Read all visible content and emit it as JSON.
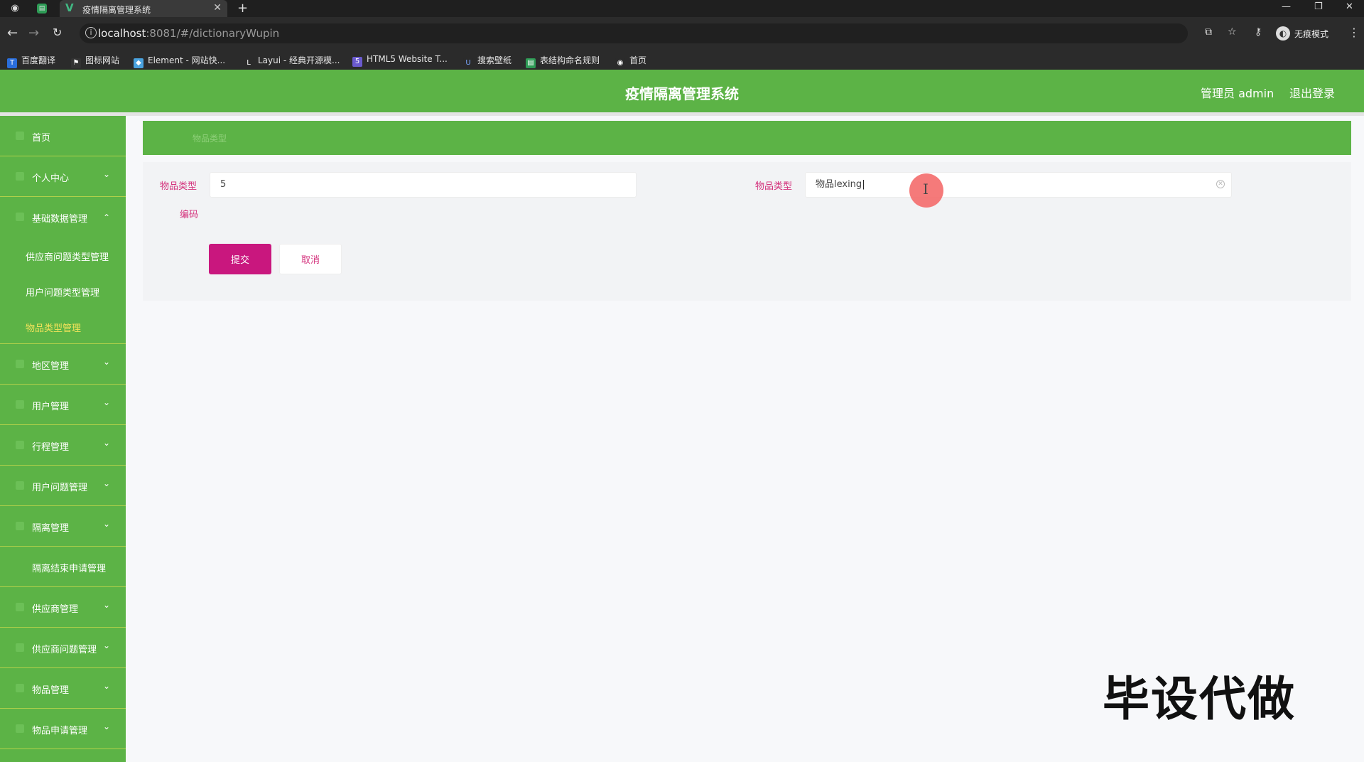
{
  "browser": {
    "tab_title": "疫情隔离管理系统",
    "url_host": "localhost",
    "url_path": ":8081/#/dictionaryWupin",
    "incognito_label": "无痕模式",
    "bookmarks": [
      "百度翻译",
      "图标网站",
      "Element - 网站快...",
      "Layui - 经典开源模...",
      "HTML5 Website T...",
      "搜索壁纸",
      "表结构命名规则",
      "首页"
    ]
  },
  "header": {
    "title": "疫情隔离管理系统",
    "user": "管理员 admin",
    "logout": "退出登录"
  },
  "sidebar": {
    "items": [
      {
        "label": "首页",
        "type": "item",
        "chevron": ""
      },
      {
        "label": "个人中心",
        "type": "item",
        "chevron": "⌄"
      },
      {
        "label": "基础数据管理",
        "type": "item",
        "chevron": "⌃"
      },
      {
        "label": "供应商问题类型管理",
        "type": "sub"
      },
      {
        "label": "用户问题类型管理",
        "type": "sub"
      },
      {
        "label": "物品类型管理",
        "type": "sub-active"
      },
      {
        "label": "地区管理",
        "type": "item",
        "chevron": "⌄"
      },
      {
        "label": "用户管理",
        "type": "item",
        "chevron": "⌄"
      },
      {
        "label": "行程管理",
        "type": "item",
        "chevron": "⌄"
      },
      {
        "label": "用户问题管理",
        "type": "item",
        "chevron": "⌄"
      },
      {
        "label": "隔离管理",
        "type": "item",
        "chevron": "⌄"
      },
      {
        "label": "隔离结束申请管理",
        "type": "item",
        "chevron": ""
      },
      {
        "label": "供应商管理",
        "type": "item",
        "chevron": "⌄"
      },
      {
        "label": "供应商问题管理",
        "type": "item",
        "chevron": "⌄"
      },
      {
        "label": "物品管理",
        "type": "item",
        "chevron": "⌄"
      },
      {
        "label": "物品申请管理",
        "type": "item",
        "chevron": "⌄"
      }
    ]
  },
  "breadcrumb": "物品类型",
  "form": {
    "code_label_line1": "物品类型",
    "code_label_line2": "编码",
    "code_value": "5",
    "name_label": "物品类型",
    "name_value": "物品lexing",
    "submit": "提交",
    "cancel": "取消"
  },
  "watermark": "毕设代做",
  "colors": {
    "brand_green": "#5cb346",
    "accent_pink": "#c9177e",
    "active_yellow": "#f3e35a"
  }
}
